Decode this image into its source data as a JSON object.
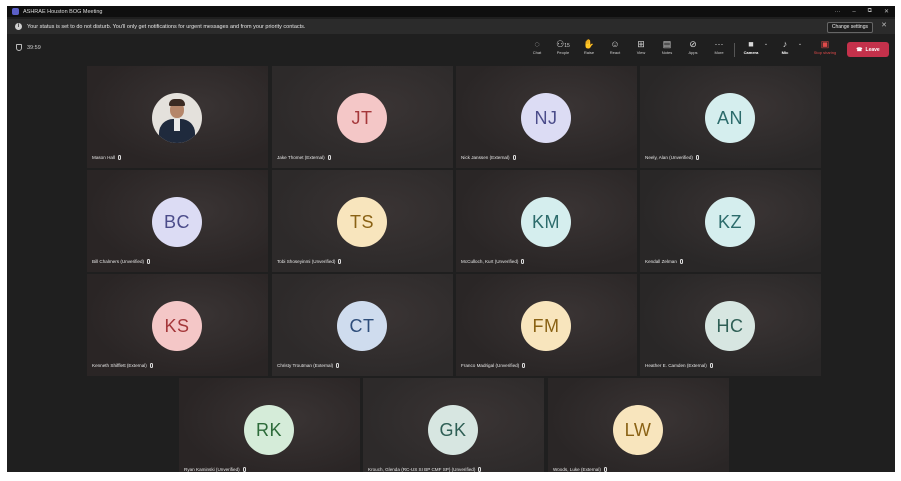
{
  "window": {
    "title": "ASHRAE Houston BOG Meeting",
    "controls": [
      "···",
      "–",
      "⧉",
      "✕"
    ]
  },
  "banner": {
    "message": "Your status is set to do not disturb. You'll only get notifications for urgent messages and from your priority contacts.",
    "change_settings": "Change settings",
    "close": "✕"
  },
  "toolbar": {
    "timer": "39:59",
    "chat": "Chat",
    "people": "People",
    "people_count": "15",
    "raise": "Raise",
    "react": "React",
    "view": "View",
    "notes": "Notes",
    "apps": "Apps",
    "more": "More",
    "camera": "Camera",
    "mic": "Mic",
    "share": "Stop sharing",
    "leave": "Leave"
  },
  "colors": {
    "leave": "#c4314b",
    "avatar_pink_bg": "#f4c7c7",
    "avatar_pink_fg": "#a4373a",
    "avatar_lavender_bg": "#dcdcf4",
    "avatar_lavender_fg": "#4b4c8a",
    "avatar_mint_bg": "#d5eeee",
    "avatar_mint_fg": "#2c6b6b",
    "avatar_yellow_bg": "#f8e5bd",
    "avatar_yellow_fg": "#8a6215",
    "avatar_blue_bg": "#cfdcee",
    "avatar_blue_fg": "#2e4d7a",
    "avatar_sage_bg": "#d7e6e1",
    "avatar_sage_fg": "#2f5f55",
    "avatar_green_bg": "#d5ecd9",
    "avatar_green_fg": "#2d6b3a"
  },
  "participants": [
    {
      "initials": "",
      "name": "Mason Hall",
      "photo": true
    },
    {
      "initials": "JT",
      "name": "Jake Thomet (External)"
    },
    {
      "initials": "NJ",
      "name": "Nick Janssen (External)"
    },
    {
      "initials": "AN",
      "name": "Neely, Alan (Unverified)"
    },
    {
      "initials": "BC",
      "name": "Bill Chalmers (Unverified)"
    },
    {
      "initials": "TS",
      "name": "Tobi Shoseyinmi (Unverified)"
    },
    {
      "initials": "KM",
      "name": "McCulloch, Kurt (Unverified)"
    },
    {
      "initials": "KZ",
      "name": "Kendall Zelman"
    },
    {
      "initials": "KS",
      "name": "Kenneth Shifflett (External)"
    },
    {
      "initials": "CT",
      "name": "Christy Troutman (External)"
    },
    {
      "initials": "FM",
      "name": "Franco Madrigal (Unverified)"
    },
    {
      "initials": "HC",
      "name": "Heather E. Camden (External)"
    },
    {
      "initials": "RK",
      "name": "Ryan Kaminski (Unverified)"
    },
    {
      "initials": "GK",
      "name": "Krouch, Glenda (RC-US SI BP CMF SP) (Unverified)"
    },
    {
      "initials": "LW",
      "name": "Woods, Luke (External)"
    }
  ]
}
